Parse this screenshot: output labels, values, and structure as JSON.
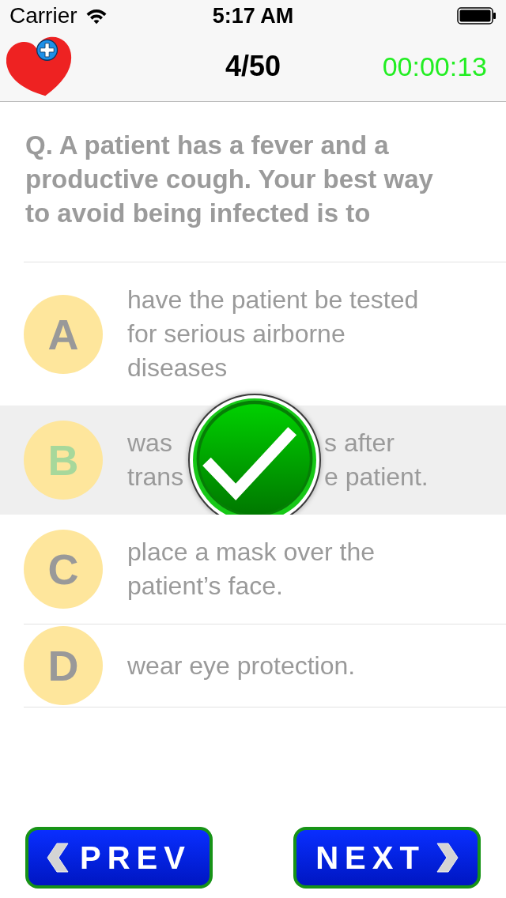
{
  "status_bar": {
    "carrier": "Carrier",
    "time": "5:17 AM"
  },
  "header": {
    "progress": "4/50",
    "timer": "00:00:13"
  },
  "question": "Q. A patient has a fever and a productive cough. Your best way to avoid being infected is to",
  "options": [
    {
      "letter": "A",
      "kind": "full",
      "text": "have the patient be tested for serious airborne diseases",
      "selected": false
    },
    {
      "letter": "B",
      "kind": "covered",
      "visible_lines": [
        [
          "was",
          "s after"
        ],
        [
          "trans",
          "e patient."
        ]
      ],
      "selected": true
    },
    {
      "letter": "C",
      "kind": "full",
      "text": "place a mask over the patient’s face.",
      "selected": false
    },
    {
      "letter": "D",
      "kind": "full",
      "text": "wear eye protection.",
      "selected": false
    }
  ],
  "answer_correct": true,
  "buttons": [
    {
      "kind": "prev",
      "label": "PREV"
    },
    {
      "kind": "next",
      "label": "NEXT"
    }
  ]
}
